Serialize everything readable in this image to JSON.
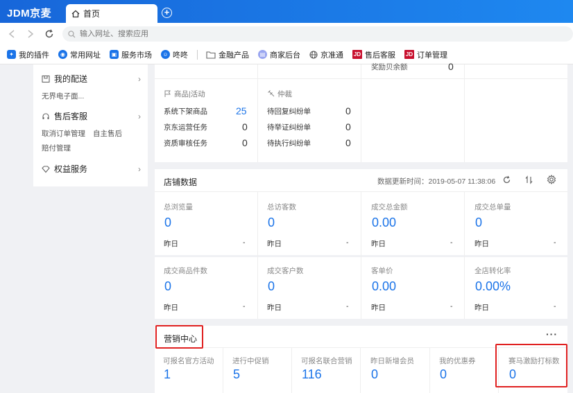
{
  "browser": {
    "brand": "JDM京麦",
    "tab_label": "首页",
    "new_tab": "+",
    "url_placeholder": "输入网址、搜索应用"
  },
  "bookmarks": [
    {
      "label": "我的插件",
      "color": "#1a73e8",
      "glyph": "✦"
    },
    {
      "label": "常用网址",
      "color": "#1a73e8",
      "glyph": "◉"
    },
    {
      "label": "服务市场",
      "color": "#1a73e8",
      "glyph": "▣"
    },
    {
      "label": "咚咚",
      "color": "#1a73e8",
      "glyph": "☺"
    },
    {
      "label": "金融产品",
      "color": "none",
      "glyph": "🗀"
    },
    {
      "label": "商家后台",
      "color": "#9aa6f0",
      "glyph": "▤"
    },
    {
      "label": "京准通",
      "color": "none",
      "glyph": "⊕"
    },
    {
      "label": "售后客服",
      "color": "#c8102e",
      "glyph": "JD"
    },
    {
      "label": "订单管理",
      "color": "#c8102e",
      "glyph": "JD"
    }
  ],
  "left_panel": {
    "delivery": {
      "title": "我的配送",
      "sub": "无界电子面..."
    },
    "service": {
      "title": "售后客服",
      "sub1": "取消订单管理",
      "sub2": "自主售后",
      "sub3": "赔付管理"
    },
    "rights": {
      "title": "权益服务"
    }
  },
  "top_card": {
    "partial_label": "奖励贝余额",
    "partial_value": "0",
    "goods": {
      "title": "商品|活动",
      "rows": [
        {
          "label": "系统下架商品",
          "value": "25"
        },
        {
          "label": "京东运营任务",
          "value": "0"
        },
        {
          "label": "资质审核任务",
          "value": "0"
        }
      ]
    },
    "arbitration": {
      "title": "仲裁",
      "rows": [
        {
          "label": "待回复纠纷单",
          "value": "0"
        },
        {
          "label": "待举证纠纷单",
          "value": "0"
        },
        {
          "label": "待执行纠纷单",
          "value": "0"
        }
      ]
    }
  },
  "store_data": {
    "title": "店铺数据",
    "update_time": "数据更新时间：2019-05-07 11:38:06",
    "metrics": [
      {
        "label": "总浏览量",
        "value": "0",
        "foot": "昨日",
        "dash": "-"
      },
      {
        "label": "总访客数",
        "value": "0",
        "foot": "昨日",
        "dash": "-"
      },
      {
        "label": "成交总金额",
        "value": "0.00",
        "foot": "昨日",
        "dash": "-"
      },
      {
        "label": "成交总单量",
        "value": "0",
        "foot": "昨日",
        "dash": "-"
      },
      {
        "label": "成交商品件数",
        "value": "0",
        "foot": "昨日",
        "dash": "-"
      },
      {
        "label": "成交客户数",
        "value": "0",
        "foot": "昨日",
        "dash": "-"
      },
      {
        "label": "客单价",
        "value": "0.00",
        "foot": "昨日",
        "dash": "-"
      },
      {
        "label": "全店转化率",
        "value": "0.00%",
        "foot": "昨日",
        "dash": "-"
      }
    ]
  },
  "marketing": {
    "title": "营销中心",
    "more": "···",
    "items": [
      {
        "label": "可报名官方活动",
        "value": "1"
      },
      {
        "label": "进行中促销",
        "value": "5"
      },
      {
        "label": "可报名联合营销",
        "value": "116"
      },
      {
        "label": "昨日新增会员",
        "value": "0"
      },
      {
        "label": "我的优惠券",
        "value": "0"
      },
      {
        "label": "赛马激励打标数",
        "value": "0"
      }
    ]
  },
  "colors": {
    "accent": "#1a73e8",
    "highlight": "#e02020"
  }
}
